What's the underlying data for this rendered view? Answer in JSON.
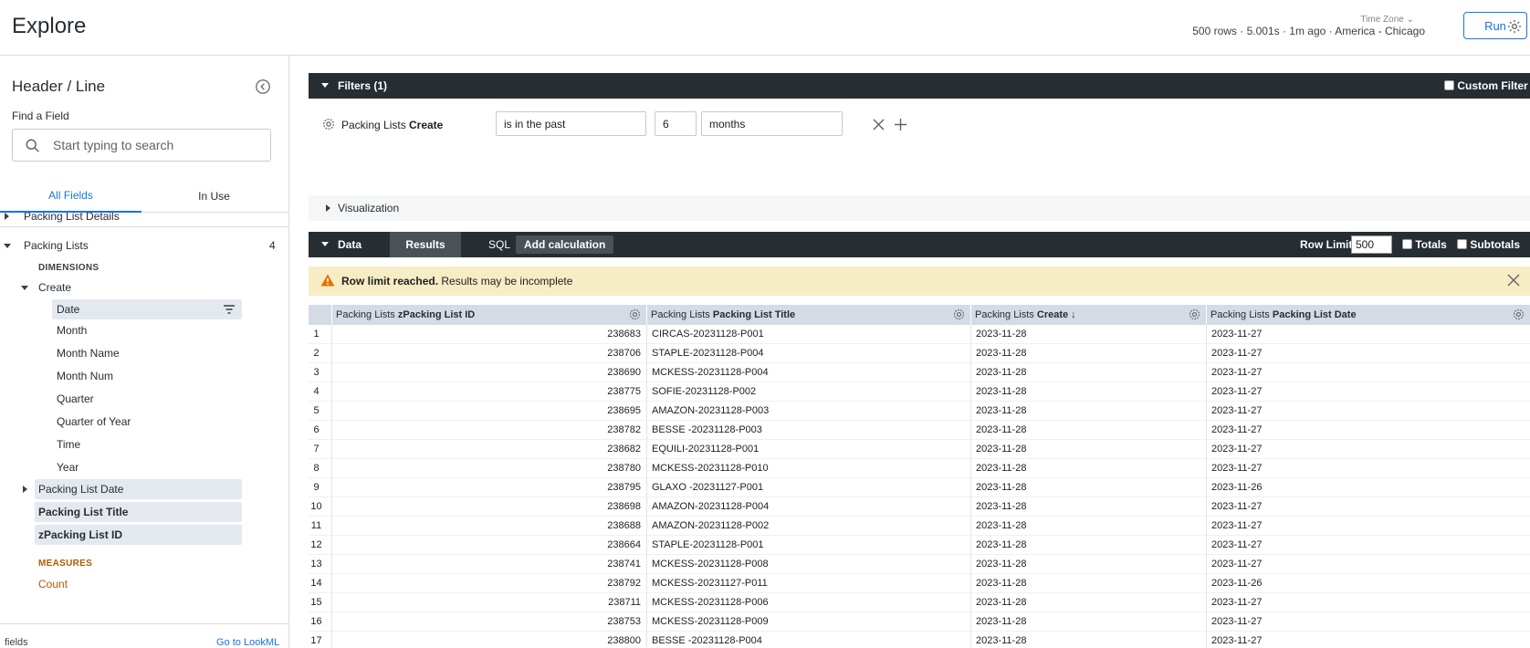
{
  "header": {
    "title": "Explore",
    "timezone_label": "Time Zone",
    "run_info": "500 rows · 5.001s · 1m ago · America - Chicago",
    "run_label": "Run"
  },
  "sidebar": {
    "title": "Header / Line",
    "find_label": "Find a Field",
    "search_placeholder": "Start typing to search",
    "tab_all": "All Fields",
    "tab_in_use": "In Use",
    "group_details": "Packing List Details",
    "group_lists": "Packing Lists",
    "group_lists_count": "4",
    "dimensions_label": "DIMENSIONS",
    "create_label": "Create",
    "create_items": [
      "Date",
      "Month",
      "Month Name",
      "Month Num",
      "Quarter",
      "Quarter of Year",
      "Time",
      "Year"
    ],
    "packing_list_date": "Packing List Date",
    "packing_list_title": "Packing List Title",
    "zpacking_list_id": "zPacking List ID",
    "measures_label": "MEASURES",
    "count_label": "Count",
    "footer_left": "fields",
    "footer_right": "Go to LookML"
  },
  "filters": {
    "label": "Filters (1)",
    "custom_filter": "Custom Filter",
    "field_view": "Packing Lists",
    "field_name": "Create",
    "operator": "is in the past",
    "value": "6",
    "unit": "months"
  },
  "visualization": {
    "label": "Visualization"
  },
  "data": {
    "label": "Data",
    "tab_results": "Results",
    "tab_sql": "SQL",
    "add_calculation": "Add calculation",
    "row_limit_label": "Row Limit",
    "row_limit_value": "500",
    "totals_label": "Totals",
    "subtotals_label": "Subtotals"
  },
  "warning": {
    "bold": "Row limit reached.",
    "text": " Results may be incomplete"
  },
  "table": {
    "columns": [
      {
        "view": "Packing Lists ",
        "field": "zPacking List ID"
      },
      {
        "view": "Packing Lists ",
        "field": "Packing List Title"
      },
      {
        "view": "Packing Lists ",
        "field": "Create ↓"
      },
      {
        "view": "Packing Lists ",
        "field": "Packing List Date"
      }
    ],
    "rows": [
      [
        "1",
        "238683",
        "CIRCAS-20231128-P001",
        "2023-11-28",
        "2023-11-27"
      ],
      [
        "2",
        "238706",
        "STAPLE-20231128-P004",
        "2023-11-28",
        "2023-11-27"
      ],
      [
        "3",
        "238690",
        "MCKESS-20231128-P004",
        "2023-11-28",
        "2023-11-27"
      ],
      [
        "4",
        "238775",
        "SOFIE-20231128-P002",
        "2023-11-28",
        "2023-11-27"
      ],
      [
        "5",
        "238695",
        "AMAZON-20231128-P003",
        "2023-11-28",
        "2023-11-27"
      ],
      [
        "6",
        "238782",
        "BESSE -20231128-P003",
        "2023-11-28",
        "2023-11-27"
      ],
      [
        "7",
        "238682",
        "EQUILI-20231128-P001",
        "2023-11-28",
        "2023-11-27"
      ],
      [
        "8",
        "238780",
        "MCKESS-20231128-P010",
        "2023-11-28",
        "2023-11-27"
      ],
      [
        "9",
        "238795",
        "GLAXO -20231127-P001",
        "2023-11-28",
        "2023-11-26"
      ],
      [
        "10",
        "238698",
        "AMAZON-20231128-P004",
        "2023-11-28",
        "2023-11-27"
      ],
      [
        "11",
        "238688",
        "AMAZON-20231128-P002",
        "2023-11-28",
        "2023-11-27"
      ],
      [
        "12",
        "238664",
        "STAPLE-20231128-P001",
        "2023-11-28",
        "2023-11-27"
      ],
      [
        "13",
        "238741",
        "MCKESS-20231128-P008",
        "2023-11-28",
        "2023-11-27"
      ],
      [
        "14",
        "238792",
        "MCKESS-20231127-P011",
        "2023-11-28",
        "2023-11-26"
      ],
      [
        "15",
        "238711",
        "MCKESS-20231128-P006",
        "2023-11-28",
        "2023-11-27"
      ],
      [
        "16",
        "238753",
        "MCKESS-20231128-P009",
        "2023-11-28",
        "2023-11-27"
      ],
      [
        "17",
        "238800",
        "BESSE -20231128-P004",
        "2023-11-28",
        "2023-11-27"
      ]
    ]
  },
  "colors": {
    "accent": "#1a73e8",
    "dark_bar": "#262d33",
    "warning_bg": "#f6edc4",
    "measure": "#b35900"
  },
  "icons": [
    "gear-icon",
    "collapse-icon",
    "search-icon",
    "caret-icon",
    "filter-icon",
    "close-icon",
    "plus-icon",
    "warning-icon",
    "sort-down-icon"
  ]
}
